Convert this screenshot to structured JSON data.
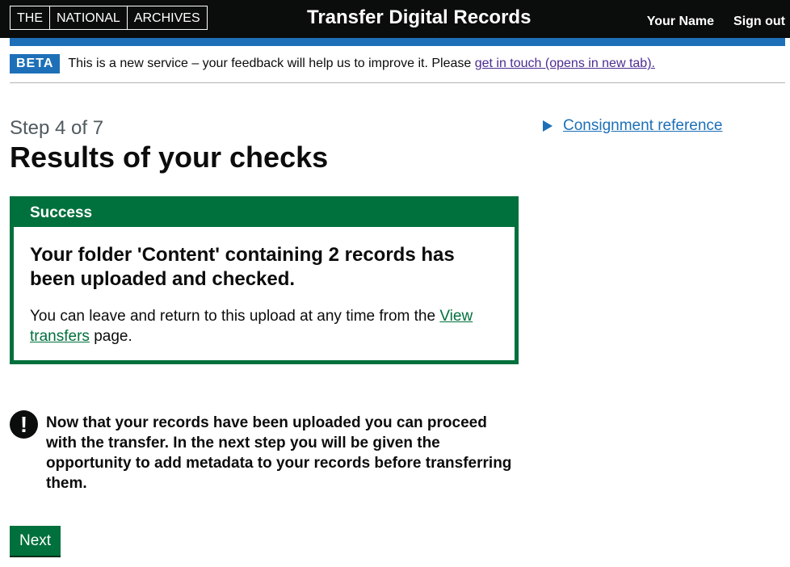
{
  "header": {
    "logo": [
      "THE",
      "NATIONAL",
      "ARCHIVES"
    ],
    "title": "Transfer Digital Records",
    "user": "Your Name",
    "sign_out": "Sign out"
  },
  "beta": {
    "tag": "BETA",
    "text": "This is a new service – your feedback will help us to improve it. Please ",
    "link": "get in touch (opens in new tab)."
  },
  "main": {
    "step": "Step 4 of 7",
    "heading": "Results of your checks",
    "banner": {
      "title": "Success",
      "heading": "Your folder 'Content' containing 2 records has been uploaded and checked.",
      "text_before": "You can leave and return to this upload at any time from the ",
      "link": "View transfers",
      "text_after": " page."
    },
    "warning": {
      "icon": "!",
      "text": "Now that your records have been uploaded you can proceed with the transfer. In the next step you will be given the opportunity to add metadata to your records before transferring them."
    },
    "next": "Next"
  },
  "sidebar": {
    "details": "Consignment reference"
  }
}
